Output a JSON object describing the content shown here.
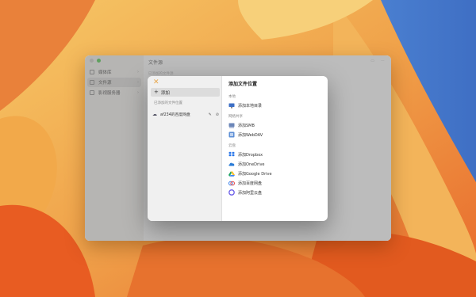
{
  "app": {
    "title": "文件源",
    "subtitle": "已添加的文件源",
    "sidebar": [
      {
        "label": "媒体库",
        "icon": "media-library-icon"
      },
      {
        "label": "文件源",
        "icon": "folder-icon",
        "active": true
      },
      {
        "label": "影视服务器",
        "icon": "server-icon"
      }
    ]
  },
  "dialog": {
    "close_icon": "close-x-icon",
    "add_label": "添加",
    "added_label": "已添加的文件位置",
    "location": {
      "label": "af234的百度网盘",
      "icon": "cloud-icon"
    },
    "title": "添加文件位置",
    "sections": [
      {
        "label": "本地",
        "options": [
          {
            "label": "添加本地目录",
            "icon": "monitor-icon"
          }
        ]
      },
      {
        "label": "网络共享",
        "options": [
          {
            "label": "添加SMB",
            "icon": "network-drive-icon"
          },
          {
            "label": "添加WebDAV",
            "icon": "webdav-icon"
          }
        ]
      },
      {
        "label": "云盘",
        "options": [
          {
            "label": "添加Dropbox",
            "icon": "dropbox-icon"
          },
          {
            "label": "添加OneDrive",
            "icon": "onedrive-icon"
          },
          {
            "label": "添加Google Drive",
            "icon": "google-drive-icon"
          },
          {
            "label": "添加百度网盘",
            "icon": "baidu-netdisk-icon"
          },
          {
            "label": "添加阿里云盘",
            "icon": "aliyun-drive-icon"
          }
        ]
      }
    ]
  },
  "colors": {
    "accent": "#e8a64b",
    "dropbox": "#1e6fe8",
    "onedrive": "#2a7bd6"
  }
}
